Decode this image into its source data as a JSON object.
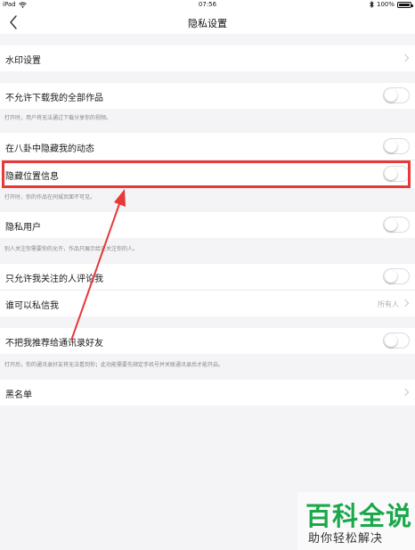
{
  "status_bar": {
    "device": "iPad",
    "time": "07:56",
    "battery": "100%"
  },
  "nav": {
    "title": "隐私设置"
  },
  "rows": {
    "watermark": {
      "label": "水印设置"
    },
    "no_download": {
      "label": "不允许下载我的全部作品",
      "hint": "打开时，用户将无法通过下载分享你的视频。"
    },
    "hide_gossip": {
      "label": "在八卦中隐藏我的动态"
    },
    "hide_location": {
      "label": "隐藏位置信息",
      "hint": "打开时，你的作品在同城页面不可见。"
    },
    "private_user": {
      "label": "隐私用户",
      "hint": "别人关注你需要你的允许，作品只展示给已关注你的人。"
    },
    "comment_following_only": {
      "label": "只允许我关注的人评论我"
    },
    "who_can_message": {
      "label": "谁可以私信我",
      "value": "所有人"
    },
    "no_recommend_contacts": {
      "label": "不把我推荐给通讯录好友",
      "hint": "打开后，你的通讯录好友将无法看到你；此功能需要先绑定手机号并关联通讯录后才能开启。"
    },
    "blacklist": {
      "label": "黑名单"
    }
  },
  "watermark_brand": {
    "title": "百科全说",
    "subtitle": "助你轻松解决"
  },
  "colors": {
    "highlight": "#e83838",
    "brand_green": "#1aa84a",
    "background": "#f4f4f6"
  }
}
